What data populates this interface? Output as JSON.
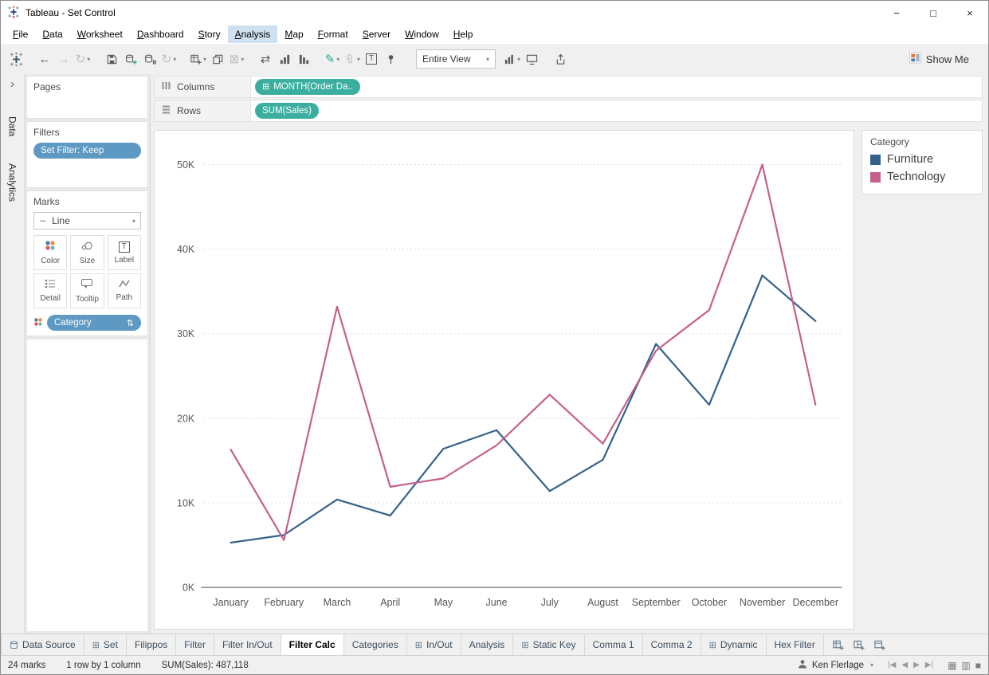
{
  "titlebar": {
    "title": "Tableau - Set Control",
    "window_controls": [
      "minimize",
      "maximize",
      "close"
    ]
  },
  "menu": {
    "items": [
      "File",
      "Data",
      "Worksheet",
      "Dashboard",
      "Story",
      "Analysis",
      "Map",
      "Format",
      "Server",
      "Window",
      "Help"
    ],
    "active": "Analysis"
  },
  "toolbar": {
    "buttons": [
      {
        "name": "undo",
        "icon": "arrow-left"
      },
      {
        "name": "redo",
        "icon": "arrow-right",
        "disabled": true
      },
      {
        "name": "replay",
        "icon": "replay",
        "disabled": true,
        "caret": true
      },
      {
        "sep": true
      },
      {
        "name": "save",
        "icon": "save"
      },
      {
        "name": "new-data-source",
        "icon": "db-add"
      },
      {
        "name": "pause-auto-updates",
        "icon": "db-pause"
      },
      {
        "name": "run-auto-updates",
        "icon": "refresh",
        "disabled": true,
        "caret": true
      },
      {
        "sep": true
      },
      {
        "name": "new-worksheet",
        "icon": "sheet-add",
        "caret": true
      },
      {
        "name": "duplicate",
        "icon": "duplicate"
      },
      {
        "name": "clear-sheet",
        "icon": "clear",
        "disabled": true,
        "caret": true
      },
      {
        "sep": true
      },
      {
        "name": "swap-rows-and-columns",
        "icon": "swap"
      },
      {
        "name": "sort-ascending",
        "icon": "sort-asc"
      },
      {
        "name": "sort-descending",
        "icon": "sort-desc"
      },
      {
        "sep": true
      },
      {
        "name": "highlight",
        "icon": "highlight",
        "caret": true
      },
      {
        "name": "group-members",
        "icon": "paperclip",
        "disabled": true,
        "caret": true
      },
      {
        "name": "show-mark-labels",
        "icon": "text-label"
      },
      {
        "name": "fix-axes",
        "icon": "pin"
      },
      {
        "sep": true
      },
      {
        "name": "fit-selector",
        "type": "dropdown",
        "label": "Entire View"
      },
      {
        "name": "show-hide-cards",
        "icon": "cards",
        "caret": true
      },
      {
        "name": "presentation-mode",
        "icon": "presentation"
      },
      {
        "sep": true
      },
      {
        "name": "share-workbook",
        "icon": "share"
      }
    ],
    "fit_selector": "Entire View",
    "show_me": "Show Me"
  },
  "panes": {
    "collapsed_tabs": [
      "Data",
      "Analytics"
    ],
    "expand_icon": "›"
  },
  "cards": {
    "pages": {
      "title": "Pages"
    },
    "filters": {
      "title": "Filters",
      "pills": [
        {
          "label": "Set Filter: Keep",
          "color": "#5d99c2"
        }
      ]
    },
    "marks": {
      "title": "Marks",
      "mark_type": "Line",
      "buttons": [
        "Color",
        "Size",
        "Label",
        "Detail",
        "Tooltip",
        "Path"
      ],
      "encodings": [
        {
          "shelf": "color",
          "field": "Category",
          "color": "#5d99c2"
        }
      ]
    }
  },
  "shelves": {
    "columns": {
      "label": "Columns",
      "pills": [
        {
          "label": "MONTH(Order Da..",
          "color": "#3bae9f"
        }
      ]
    },
    "rows": {
      "label": "Rows",
      "pills": [
        {
          "label": "SUM(Sales)",
          "color": "#3bae9f"
        }
      ]
    }
  },
  "legend": {
    "title": "Category",
    "items": [
      {
        "label": "Furniture",
        "color": "#34618c"
      },
      {
        "label": "Technology",
        "color": "#c5608c"
      }
    ]
  },
  "chart_data": {
    "type": "line",
    "x_categories": [
      "January",
      "February",
      "March",
      "April",
      "May",
      "June",
      "July",
      "August",
      "September",
      "October",
      "November",
      "December"
    ],
    "series": [
      {
        "name": "Furniture",
        "color": "#34618c",
        "values": [
          5300,
          6200,
          10400,
          8500,
          16400,
          18600,
          11400,
          15100,
          28800,
          21600,
          36900,
          31500
        ]
      },
      {
        "name": "Technology",
        "color": "#c5608c",
        "values": [
          16300,
          5600,
          33200,
          11900,
          12900,
          16800,
          22800,
          17000,
          28000,
          32800,
          50000,
          21600
        ]
      }
    ],
    "yticks": [
      {
        "label": "0K",
        "value": 0
      },
      {
        "label": "10K",
        "value": 10000
      },
      {
        "label": "20K",
        "value": 20000
      },
      {
        "label": "30K",
        "value": 30000
      },
      {
        "label": "40K",
        "value": 40000
      },
      {
        "label": "50K",
        "value": 50000
      }
    ],
    "ylim": [
      0,
      52500
    ],
    "grid": "horizontal-dotted",
    "legend_position": "right",
    "xlabel": "",
    "ylabel": ""
  },
  "sheet_tabs": {
    "tabs": [
      {
        "label": "Data Source",
        "type": "datasource"
      },
      {
        "label": "Set",
        "type": "dashboard"
      },
      {
        "label": "Filippos",
        "type": "worksheet"
      },
      {
        "label": "Filter",
        "type": "worksheet"
      },
      {
        "label": "Filter In/Out",
        "type": "worksheet"
      },
      {
        "label": "Filter Calc",
        "type": "worksheet"
      },
      {
        "label": "Categories",
        "type": "worksheet"
      },
      {
        "label": "In/Out",
        "type": "dashboard"
      },
      {
        "label": "Analysis",
        "type": "worksheet"
      },
      {
        "label": "Static Key",
        "type": "dashboard"
      },
      {
        "label": "Comma 1",
        "type": "worksheet"
      },
      {
        "label": "Comma 2",
        "type": "worksheet"
      },
      {
        "label": "Dynamic",
        "type": "dashboard"
      },
      {
        "label": "Hex Filter",
        "type": "worksheet"
      }
    ],
    "active": "Filter Calc"
  },
  "statusbar": {
    "marks": "24 marks",
    "layout": "1 row by 1 column",
    "aggregate": "SUM(Sales): 487,118",
    "user": "Ken Flerlage"
  }
}
